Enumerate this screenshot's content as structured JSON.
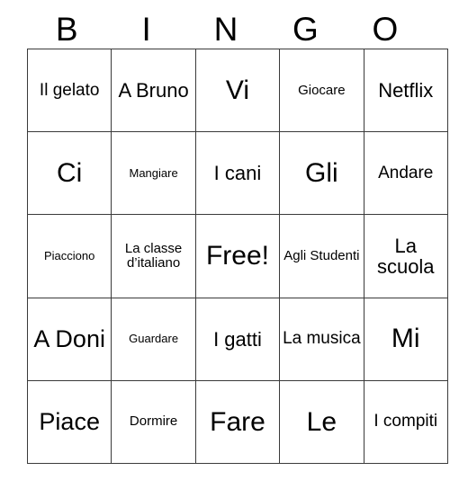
{
  "card": {
    "headers": [
      "B",
      "I",
      "N",
      "G",
      "O"
    ],
    "rows": [
      [
        {
          "text": "Il gelato",
          "size": "md"
        },
        {
          "text": "A Bruno",
          "size": "lg"
        },
        {
          "text": "Vi",
          "size": "xxl"
        },
        {
          "text": "Giocare",
          "size": "sm"
        },
        {
          "text": "Netflix",
          "size": "lg"
        }
      ],
      [
        {
          "text": "Ci",
          "size": "xxl"
        },
        {
          "text": "Mangiare",
          "size": "xs"
        },
        {
          "text": "I cani",
          "size": "lg"
        },
        {
          "text": "Gli",
          "size": "xxl"
        },
        {
          "text": "Andare",
          "size": "md"
        }
      ],
      [
        {
          "text": "Piacciono",
          "size": "xs"
        },
        {
          "text": "La classe d’italiano",
          "size": "sm"
        },
        {
          "text": "Free!",
          "size": "xxl"
        },
        {
          "text": "Agli Studenti",
          "size": "sm"
        },
        {
          "text": "La scuola",
          "size": "lg"
        }
      ],
      [
        {
          "text": "A Doni",
          "size": "xl"
        },
        {
          "text": "Guardare",
          "size": "xs"
        },
        {
          "text": "I gatti",
          "size": "lg"
        },
        {
          "text": "La musica",
          "size": "md"
        },
        {
          "text": "Mi",
          "size": "xxl"
        }
      ],
      [
        {
          "text": "Piace",
          "size": "xl"
        },
        {
          "text": "Dormire",
          "size": "sm"
        },
        {
          "text": "Fare",
          "size": "xxl"
        },
        {
          "text": "Le",
          "size": "xxl"
        },
        {
          "text": "I compiti",
          "size": "md"
        }
      ]
    ],
    "free_space_label": "Free!",
    "colors": {
      "background": "#ffffff",
      "text": "#000000",
      "border": "#3a3a3a"
    }
  }
}
